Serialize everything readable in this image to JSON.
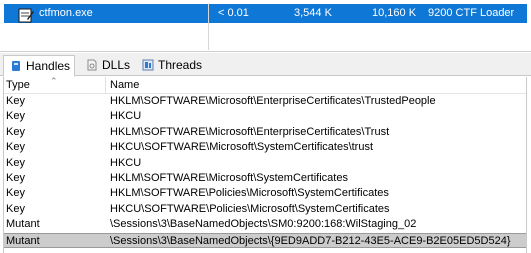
{
  "process": {
    "name": "ctfmon.exe",
    "cpu": "< 0.01",
    "private_bytes": "3,544 K",
    "working_set": "10,160 K",
    "pid_description": "9200 CTF Loader"
  },
  "tabs": [
    {
      "label": "Handles",
      "icon": "handles-icon"
    },
    {
      "label": "DLLs",
      "icon": "dlls-icon"
    },
    {
      "label": "Threads",
      "icon": "threads-icon"
    }
  ],
  "columns": {
    "type": "Type",
    "name": "Name"
  },
  "rows": [
    {
      "type": "Key",
      "name": "HKLM\\SOFTWARE\\Microsoft\\EnterpriseCertificates\\TrustedPeople"
    },
    {
      "type": "Key",
      "name": "HKCU"
    },
    {
      "type": "Key",
      "name": "HKLM\\SOFTWARE\\Microsoft\\EnterpriseCertificates\\Trust"
    },
    {
      "type": "Key",
      "name": "HKCU\\SOFTWARE\\Microsoft\\SystemCertificates\\trust"
    },
    {
      "type": "Key",
      "name": "HKCU"
    },
    {
      "type": "Key",
      "name": "HKLM\\SOFTWARE\\Microsoft\\SystemCertificates"
    },
    {
      "type": "Key",
      "name": "HKLM\\SOFTWARE\\Policies\\Microsoft\\SystemCertificates"
    },
    {
      "type": "Key",
      "name": "HKCU\\SOFTWARE\\Policies\\Microsoft\\SystemCertificates"
    },
    {
      "type": "Mutant",
      "name": "\\Sessions\\3\\BaseNamedObjects\\SM0:9200:168:WilStaging_02"
    },
    {
      "type": "Mutant",
      "name": "\\Sessions\\3\\BaseNamedObjects\\{9ED9ADD7-B212-43E5-ACE9-B2E05ED5D524}"
    }
  ],
  "selected_row": 9,
  "colors": {
    "selection_blue": "#0f78d7",
    "selected_row_gray": "#cccccc"
  }
}
